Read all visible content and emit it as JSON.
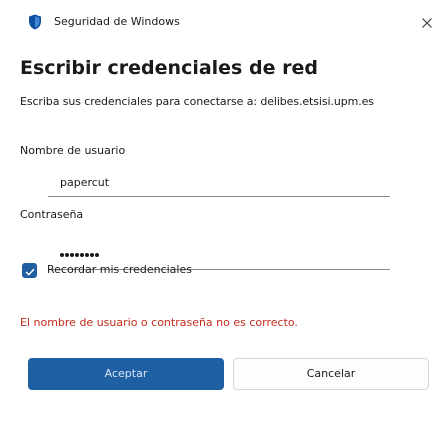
{
  "window": {
    "title": "Seguridad de Windows",
    "close_icon": "close-icon"
  },
  "dialog": {
    "heading": "Escribir credenciales de red",
    "subtitle": "Escriba sus credenciales para conectarse a: delibes.etsisi.upm.es"
  },
  "username": {
    "label": "Nombre de usuario",
    "value": "papercut"
  },
  "password": {
    "label": "Contraseña",
    "masked_length": 8
  },
  "remember": {
    "label": "Recordar mis credenciales",
    "checked": true
  },
  "error": {
    "message": "El nombre de usuario o contraseña no es correcto.",
    "color": "#c42b1c"
  },
  "buttons": {
    "ok_label": "Aceptar",
    "cancel_label": "Cancelar"
  },
  "colors": {
    "accent": "#1f5fa3",
    "shield": "#0f4fa0"
  }
}
